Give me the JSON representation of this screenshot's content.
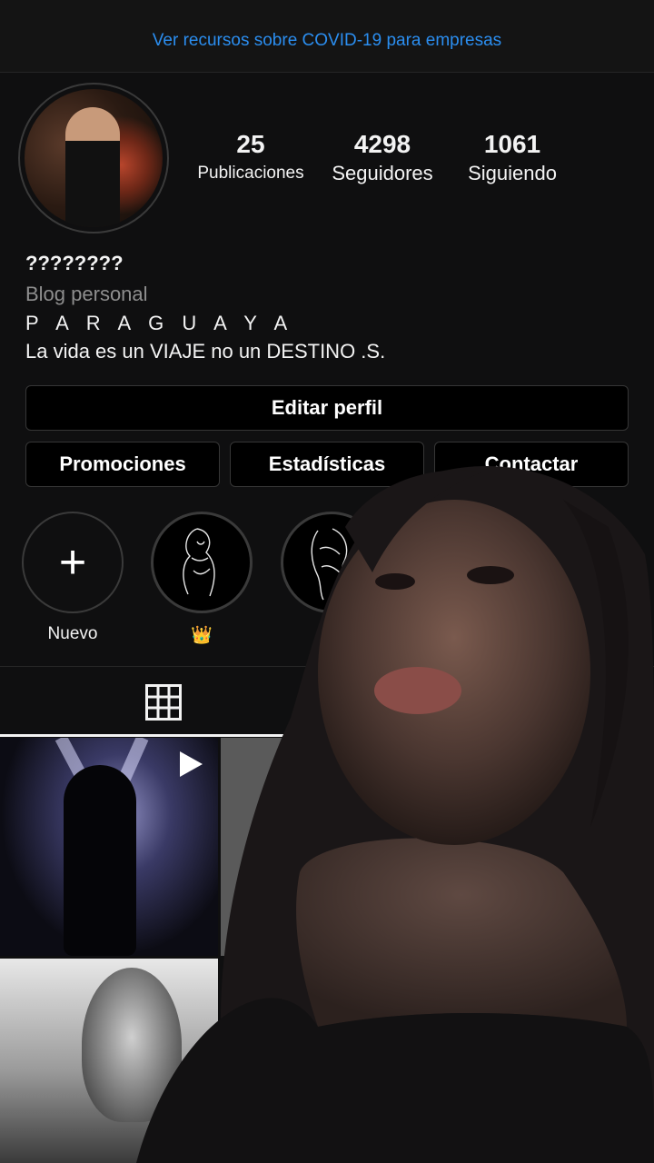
{
  "banner": {
    "link_text": "Ver recursos sobre COVID-19 para empresas"
  },
  "profile": {
    "stats": [
      {
        "value": "25",
        "label": "Publicaciones"
      },
      {
        "value": "4298",
        "label": "Seguidores"
      },
      {
        "value": "1061",
        "label": "Siguiendo"
      }
    ],
    "name": "????????",
    "category": "Blog personal",
    "bio_lines": [
      "P A R A G U A Y A",
      "La vida es un VIAJE no un DESTINO .S."
    ]
  },
  "buttons": {
    "edit_profile": "Editar perfil",
    "promotions": "Promociones",
    "insights": "Estadísticas",
    "contact": "Contactar"
  },
  "highlights": [
    {
      "label": "Nuevo",
      "icon": "plus-icon"
    },
    {
      "label": "👑",
      "icon": "line-art"
    },
    {
      "label": "",
      "icon": "line-art"
    }
  ],
  "tabs": [
    {
      "icon": "grid-icon",
      "active": true
    }
  ],
  "posts": [
    {
      "type": "video",
      "icon": "play-icon"
    },
    {
      "type": "image"
    },
    {
      "type": "image"
    }
  ],
  "colors": {
    "background": "#0f0f10",
    "link": "#2b8ef0",
    "muted": "#8e8e8e",
    "border": "#363636"
  }
}
